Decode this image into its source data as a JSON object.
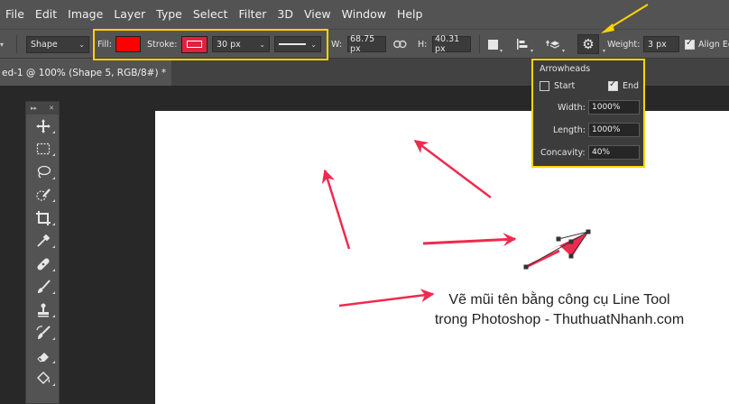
{
  "menu": [
    "File",
    "Edit",
    "Image",
    "Layer",
    "Type",
    "Select",
    "Filter",
    "3D",
    "View",
    "Window",
    "Help"
  ],
  "options": {
    "mode": "Shape",
    "fill_label": "Fill:",
    "fill_color": "#ff0000",
    "stroke_label": "Stroke:",
    "stroke_color": "#e0223f",
    "stroke_width": "30 px",
    "width_label": "W:",
    "width_value": "68.75 px",
    "height_label": "H:",
    "height_value": "40.31 px",
    "weight_label": "Weight:",
    "weight_value": "3 px",
    "align_edges_label": "Align Ed",
    "align_edges_checked": true
  },
  "document_tab": "ed-1 @ 100% (Shape 5, RGB/8#) *",
  "arrowheads": {
    "title": "Arrowheads",
    "start_label": "Start",
    "start_checked": false,
    "end_label": "End",
    "end_checked": true,
    "width_label": "Width:",
    "width_value": "1000%",
    "length_label": "Length:",
    "length_value": "1000%",
    "concavity_label": "Concavity:",
    "concavity_value": "40%"
  },
  "caption": {
    "line1": "Vẽ mũi tên bằng công cụ Line Tool",
    "line2": "trong Photoshop - ThuthuatNhanh.com"
  },
  "colors": {
    "highlight": "#ffd400",
    "arrow": "#ef2a4f"
  },
  "tools": [
    "move-icon",
    "marquee-icon",
    "lasso-icon",
    "quick-select-icon",
    "crop-icon",
    "eyedropper-icon",
    "healing-brush-icon",
    "brush-icon",
    "clone-stamp-icon",
    "history-brush-icon",
    "eraser-icon",
    "paint-bucket-icon"
  ]
}
